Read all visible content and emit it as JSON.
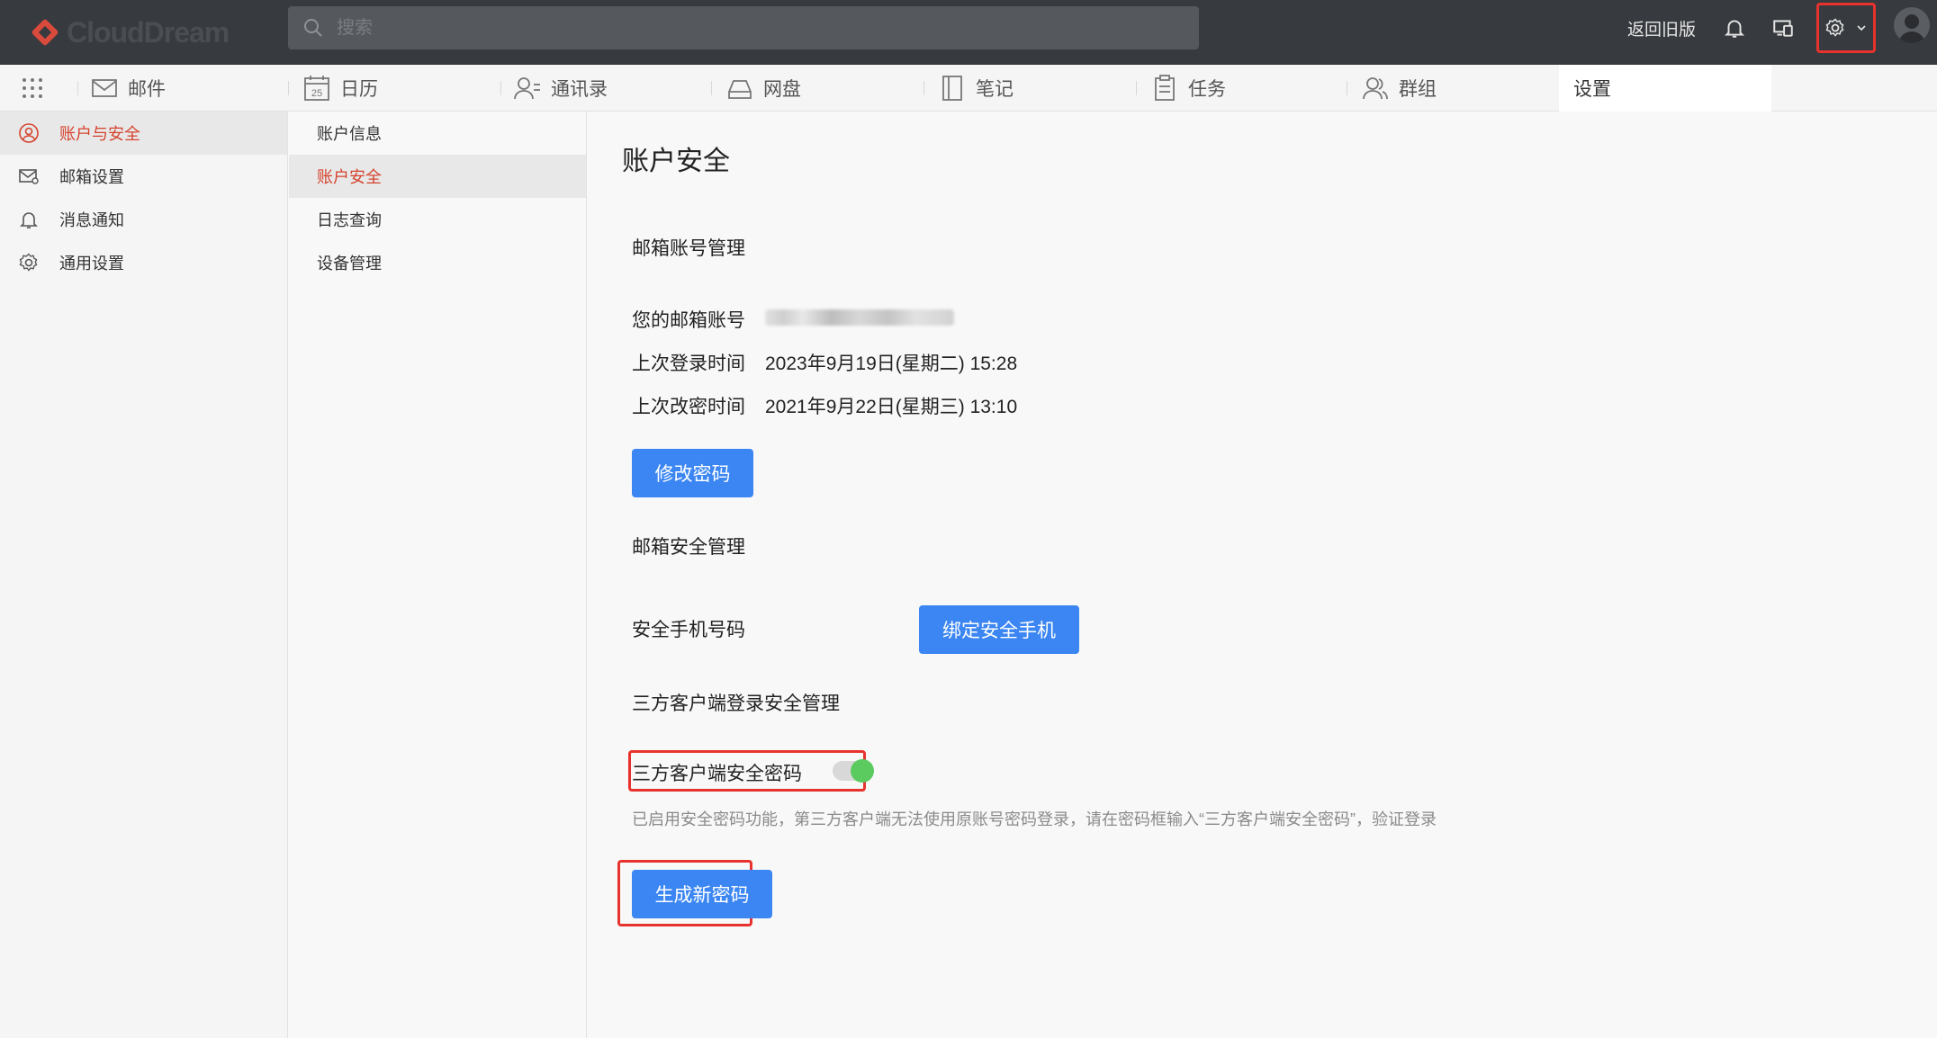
{
  "app": {
    "logo_text": "CloudDream",
    "search_placeholder": "搜索",
    "old_version_label": "返回旧版"
  },
  "nav": {
    "items": [
      {
        "label": "邮件",
        "icon": "mail-icon"
      },
      {
        "label": "日历",
        "icon": "calendar-icon",
        "calendar_day": "25"
      },
      {
        "label": "通讯录",
        "icon": "contacts-icon"
      },
      {
        "label": "网盘",
        "icon": "drive-icon"
      },
      {
        "label": "笔记",
        "icon": "notes-icon"
      },
      {
        "label": "任务",
        "icon": "tasks-icon"
      },
      {
        "label": "群组",
        "icon": "group-icon"
      }
    ],
    "active_label": "设置"
  },
  "sidebar": {
    "items": [
      {
        "label": "账户与安全",
        "icon": "user-circle-icon",
        "active": true
      },
      {
        "label": "邮箱设置",
        "icon": "mail-settings-icon"
      },
      {
        "label": "消息通知",
        "icon": "bell-icon"
      },
      {
        "label": "通用设置",
        "icon": "gear-icon"
      }
    ]
  },
  "submenu": {
    "items": [
      {
        "label": "账户信息"
      },
      {
        "label": "账户安全",
        "active": true
      },
      {
        "label": "日志查询"
      },
      {
        "label": "设备管理"
      }
    ]
  },
  "main": {
    "title": "账户安全",
    "account_section": "邮箱账号管理",
    "email_label": "您的邮箱账号",
    "last_login_label": "上次登录时间",
    "last_login_value": "2023年9月19日(星期二) 15:28",
    "last_pwd_change_label": "上次改密时间",
    "last_pwd_change_value": "2021年9月22日(星期三) 13:10",
    "change_password_button": "修改密码",
    "security_section": "邮箱安全管理",
    "phone_label": "安全手机号码",
    "bind_phone_button": "绑定安全手机",
    "third_party_section": "三方客户端登录安全管理",
    "third_party_toggle_label": "三方客户端安全密码",
    "third_party_toggle_on": true,
    "third_party_hint": "已启用安全密码功能，第三方客户端无法使用原账号密码登录，请在密码框输入“三方客户端安全密码”，验证登录",
    "generate_password_button": "生成新密码"
  },
  "colors": {
    "accent": "#3b86f2",
    "active_text": "#d5432e",
    "highlight": "#e8322d",
    "toggle_on": "#5ccb5f",
    "topbar": "#373a3e"
  }
}
